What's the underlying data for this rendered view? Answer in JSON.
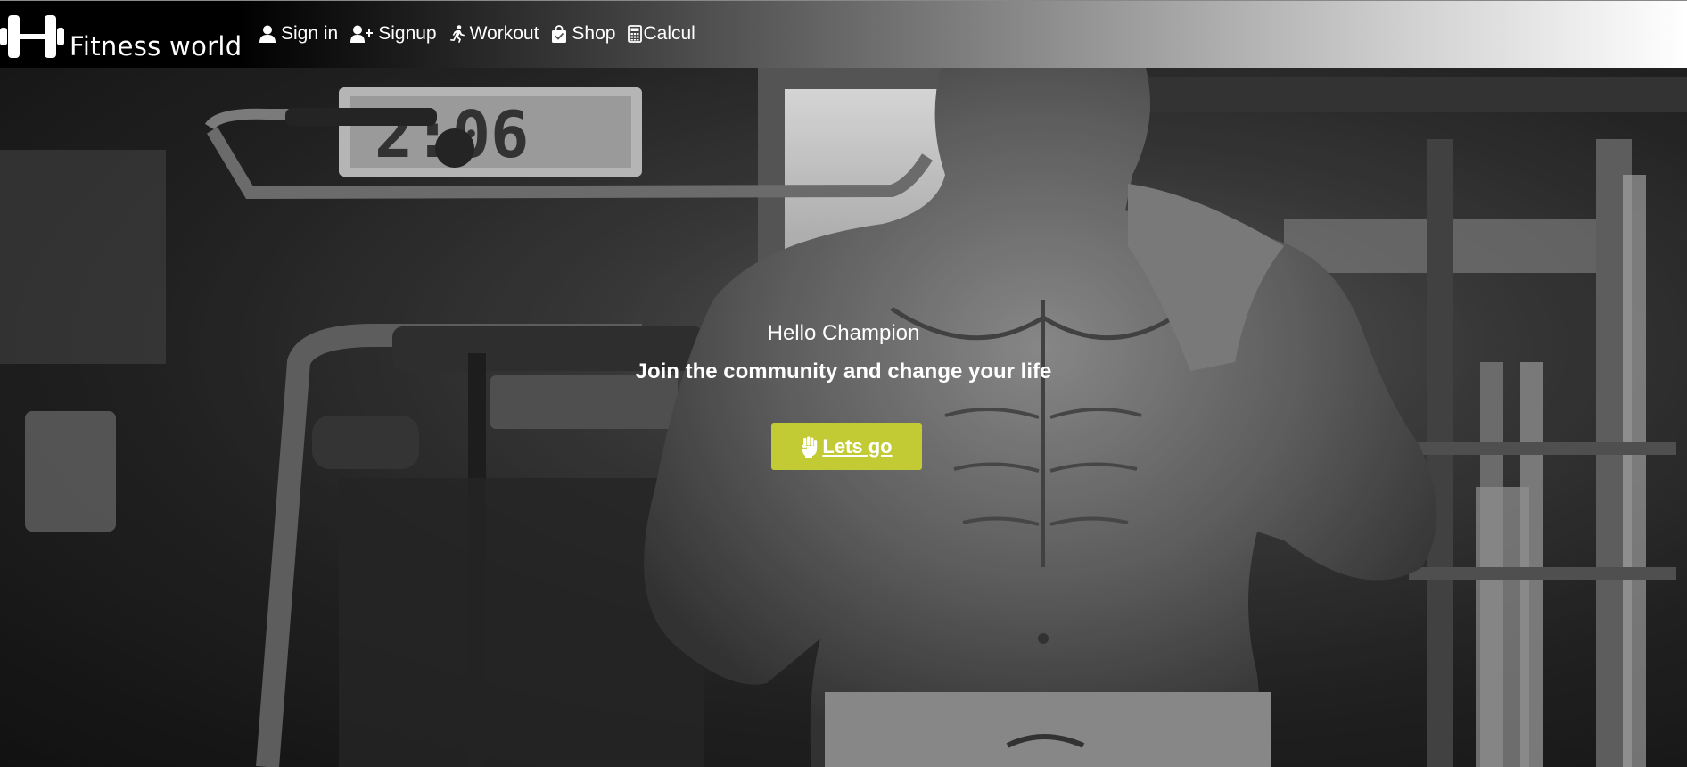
{
  "nav": {
    "brand": "Fitness world",
    "links": [
      {
        "label": "Sign in",
        "icon": "user-icon"
      },
      {
        "label": "Signup",
        "icon": "user-plus-icon"
      },
      {
        "label": "Workout",
        "icon": "running-person-icon"
      },
      {
        "label": "Shop",
        "icon": "shopping-bag-icon"
      },
      {
        "label": "Calcul",
        "icon": "calculator-icon"
      }
    ]
  },
  "hero": {
    "greeting": "Hello Champion",
    "tagline": "Join the community and change your life",
    "cta": {
      "label": "Lets go",
      "icon": "fist-icon",
      "color": "#c3cb34"
    },
    "gym_clock": "2:06"
  }
}
